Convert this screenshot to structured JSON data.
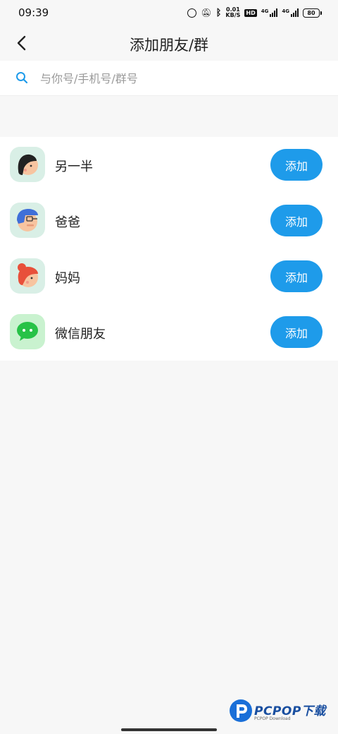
{
  "status_bar": {
    "time": "09:39",
    "speed_value": "0.01",
    "speed_unit": "KB/S",
    "hd_label": "HD",
    "network_label": "4G",
    "battery": "80"
  },
  "header": {
    "title": "添加朋友/群"
  },
  "search": {
    "placeholder": "与你号/手机号/群号",
    "value": ""
  },
  "contacts": [
    {
      "name": "另一半",
      "button_label": "添加",
      "avatar": "woman-avatar-icon"
    },
    {
      "name": "爸爸",
      "button_label": "添加",
      "avatar": "man-glasses-avatar-icon"
    },
    {
      "name": "妈妈",
      "button_label": "添加",
      "avatar": "woman-bun-avatar-icon"
    },
    {
      "name": "微信朋友",
      "button_label": "添加",
      "avatar": "wechat-icon"
    }
  ],
  "watermark": {
    "brand": "PCPOP下载",
    "sub": "PCPOP Download"
  },
  "colors": {
    "accent": "#1e9bea",
    "background": "#f7f7f7",
    "wechat_green": "#27c247"
  }
}
